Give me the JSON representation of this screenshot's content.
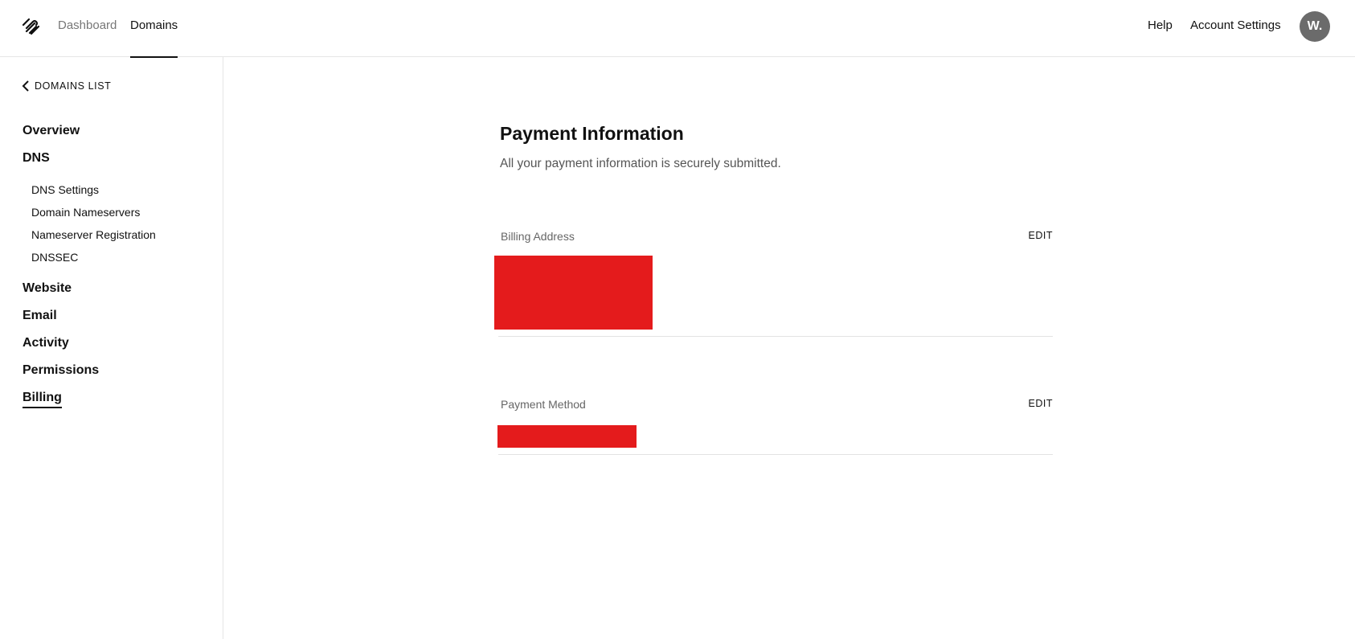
{
  "topnav": {
    "logo_icon": "squarespace-logo-icon",
    "links": [
      {
        "label": "Dashboard",
        "active": false
      },
      {
        "label": "Domains",
        "active": true
      }
    ],
    "help_label": "Help",
    "account_label": "Account Settings",
    "avatar_initials": "W."
  },
  "sidebar": {
    "back_label": "DOMAINS LIST",
    "items": {
      "overview": "Overview",
      "dns": "DNS",
      "dns_settings": "DNS Settings",
      "domain_nameservers": "Domain Nameservers",
      "nameserver_registration": "Nameserver Registration",
      "dnssec": "DNSSEC",
      "website": "Website",
      "email": "Email",
      "activity": "Activity",
      "permissions": "Permissions",
      "billing": "Billing"
    }
  },
  "main": {
    "title": "Payment Information",
    "subtitle": "All your payment information is securely submitted.",
    "billing_address": {
      "label": "Billing Address",
      "edit_label": "EDIT"
    },
    "payment_method": {
      "label": "Payment Method",
      "edit_label": "EDIT"
    }
  },
  "colors": {
    "redaction": "#e41b1c",
    "accent": "#111111"
  }
}
